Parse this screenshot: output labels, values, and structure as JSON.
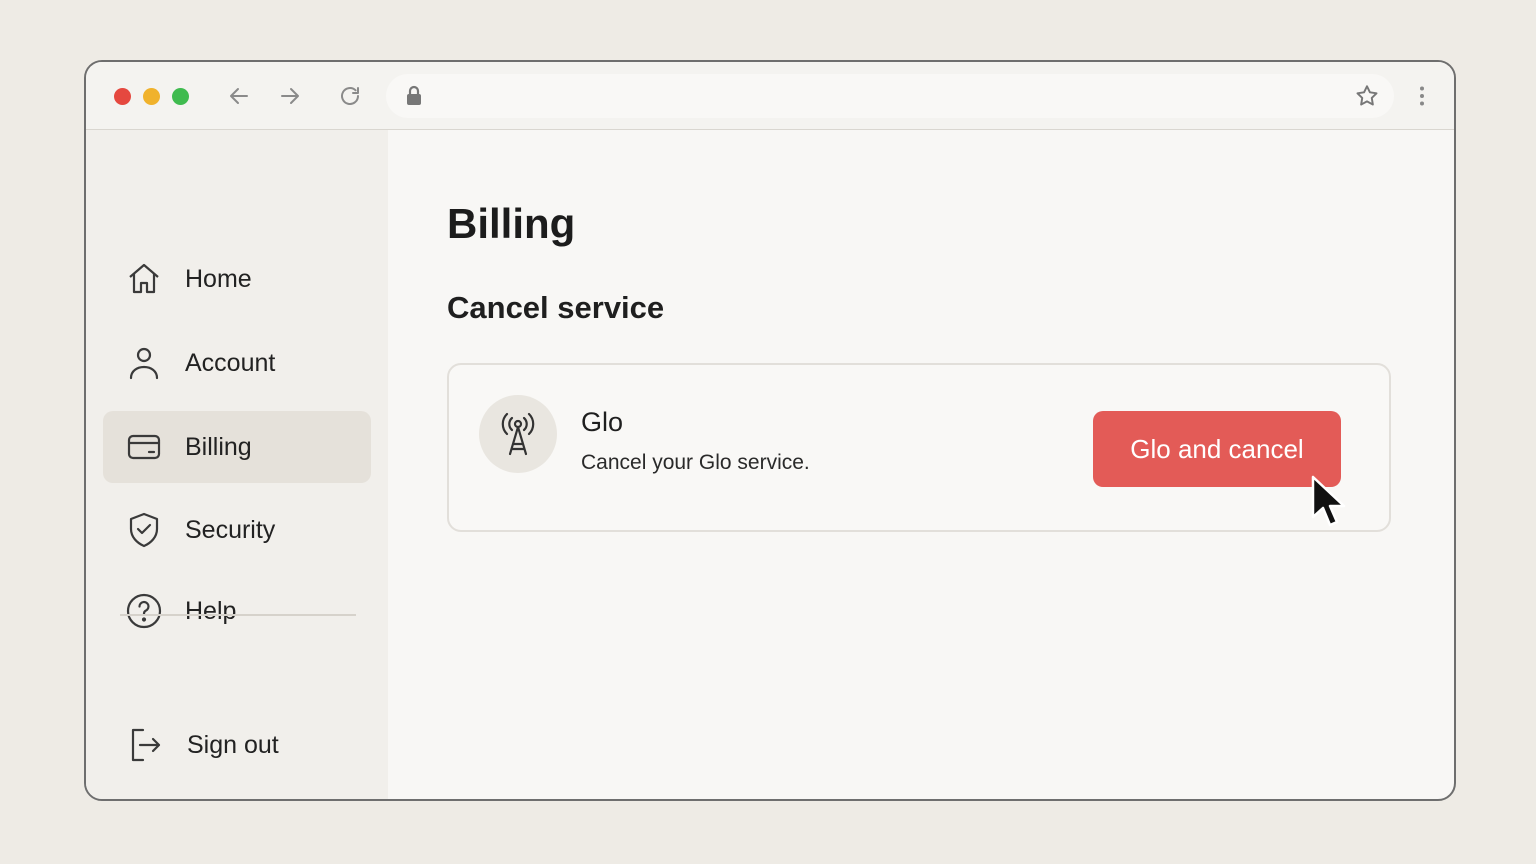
{
  "toolbar": {
    "window_controls": [
      {
        "name": "close",
        "color": "#e5483f"
      },
      {
        "name": "minimize",
        "color": "#f0b22c"
      },
      {
        "name": "maximize",
        "color": "#3fbb4f"
      }
    ],
    "icons": [
      "back-arrow-icon",
      "forward-arrow-icon",
      "reload-icon",
      "lock-icon",
      "star-icon",
      "more-vertical-icon"
    ],
    "address": {
      "value": "",
      "placeholder": ""
    }
  },
  "sidebar": {
    "items": [
      {
        "label": "Home",
        "icon": "home-icon",
        "active": false
      },
      {
        "label": "Account",
        "icon": "user-icon",
        "active": false
      },
      {
        "label": "Billing",
        "icon": "credit-card-icon",
        "active": true
      },
      {
        "label": "Security",
        "icon": "shield-check-icon",
        "active": false
      },
      {
        "label": "Help",
        "icon": "help-circle-icon",
        "active": false
      }
    ],
    "sign_out": {
      "label": "Sign out",
      "icon": "sign-out-icon"
    }
  },
  "main": {
    "title": "Billing",
    "section_title": "Cancel service",
    "service": {
      "name": "Glo",
      "description": "Cancel your Glo service.",
      "icon": "radio-tower-icon",
      "button_label": "Glo and cancel",
      "button_color": "#e35b57"
    }
  },
  "colors": {
    "background": "#eeebe5",
    "window": "#f8f7f5",
    "sidebar": "#f1efeb",
    "active_item": "#e5e1da",
    "accent": "#e35b57"
  }
}
